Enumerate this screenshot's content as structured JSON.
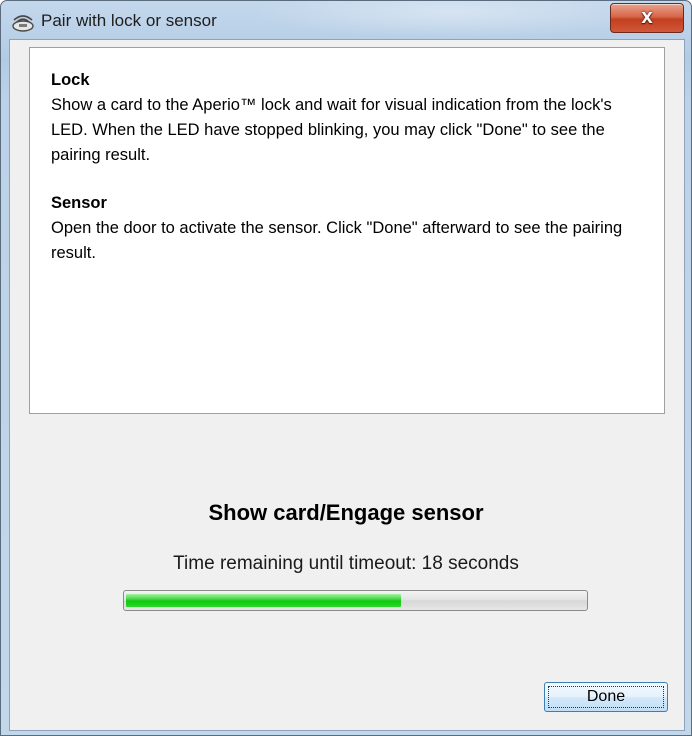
{
  "window": {
    "title": "Pair with lock or sensor",
    "icon": "wireless-lock-icon",
    "close_label": "X"
  },
  "info": {
    "lock_heading": "Lock",
    "lock_text": "Show a card to the Aperio™ lock and wait for visual indication from the lock's LED. When the LED have stopped blinking, you may click \"Done\" to see the pairing result.",
    "sensor_heading": "Sensor",
    "sensor_text": "Open the door to activate the sensor. Click \"Done\" afterward to see the pairing result."
  },
  "status": {
    "title": "Show card/Engage sensor",
    "countdown": "Time remaining until timeout: 18 seconds",
    "progress": 0.6,
    "progress_color": "#10c810"
  },
  "actions": {
    "done_label": "Done"
  }
}
